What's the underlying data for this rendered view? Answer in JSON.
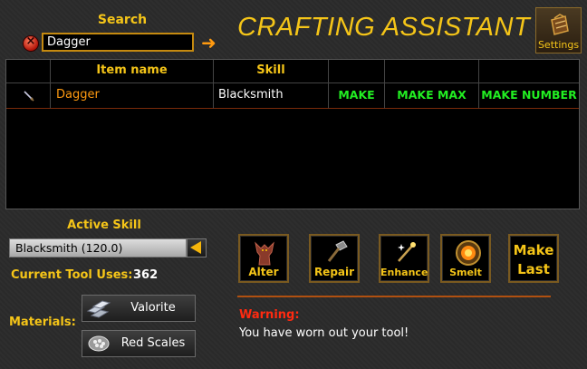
{
  "search": {
    "label": "Search",
    "value": "Dagger",
    "clear_icon": "x-circle-icon",
    "go_icon": "arrow-right-icon"
  },
  "app": {
    "title": "CRAFTING ASSISTANT"
  },
  "settings": {
    "label": "Settings",
    "icon": "backpack-icon"
  },
  "table": {
    "headers": [
      "",
      "Item name",
      "Skill",
      "",
      "",
      ""
    ],
    "rows": [
      {
        "icon": "dagger-icon",
        "item_name": "Dagger",
        "skill": "Blacksmith",
        "actions": [
          "MAKE",
          "MAKE MAX",
          "MAKE NUMBER"
        ]
      }
    ]
  },
  "active_skill": {
    "label": "Active Skill",
    "selected": "Blacksmith (120.0)"
  },
  "tool": {
    "label": "Current Tool Uses:",
    "value": "362"
  },
  "materials": {
    "label": "Materials:",
    "items": [
      {
        "label": "Valorite",
        "icon": "ingots-icon"
      },
      {
        "label": "Red Scales",
        "icon": "scales-icon"
      }
    ]
  },
  "actions": {
    "alter": "Alter",
    "repair": "Repair",
    "enhance": "Enhance",
    "smelt": "Smelt",
    "make_last_line1": "Make",
    "make_last_line2": "Last"
  },
  "warning": {
    "title": "Warning:",
    "message": "You have worn out your tool!"
  },
  "colors": {
    "gold": "#f5c518",
    "orange": "#ff9a10",
    "green": "#22ee22",
    "warning_red": "#ff2a10"
  }
}
